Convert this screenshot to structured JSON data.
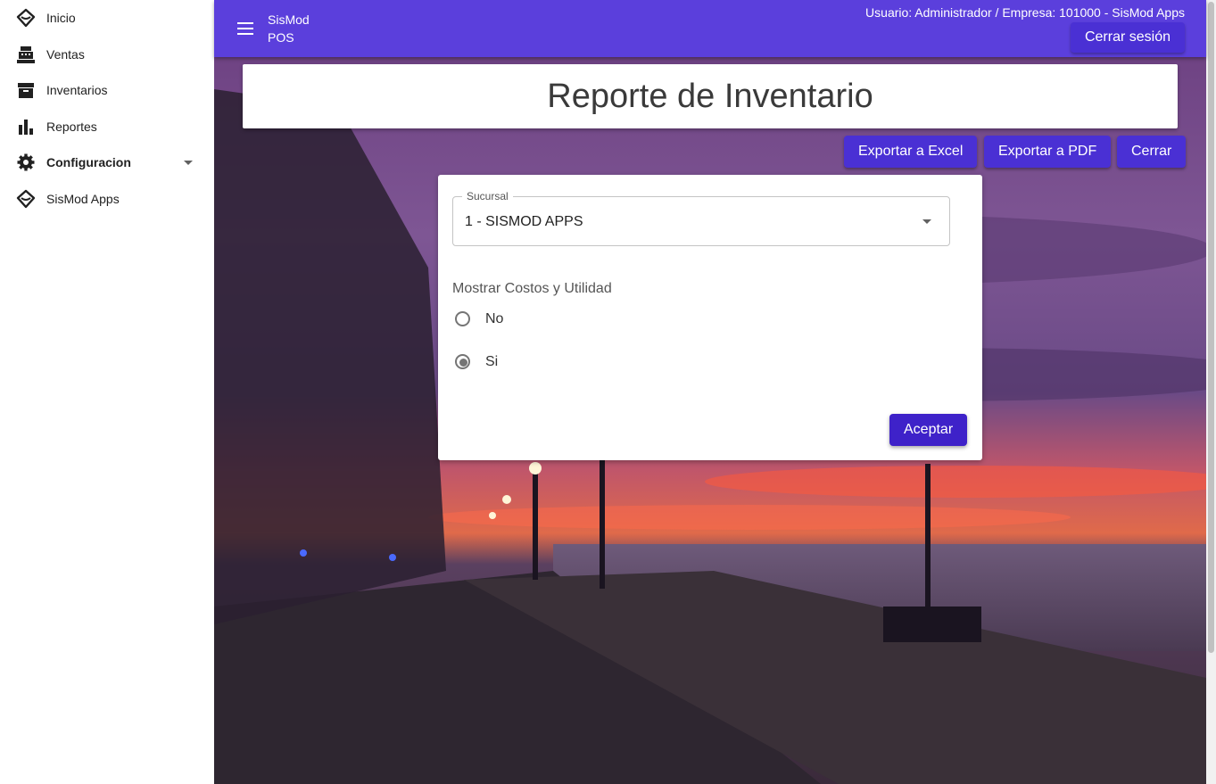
{
  "sidebar": {
    "items": [
      {
        "label": "Inicio",
        "icon": "sismod-logo-icon"
      },
      {
        "label": "Ventas",
        "icon": "cash-register-icon"
      },
      {
        "label": "Inventarios",
        "icon": "archive-box-icon"
      },
      {
        "label": "Reportes",
        "icon": "bar-chart-icon"
      },
      {
        "label": "Configuracion",
        "icon": "gear-icon"
      },
      {
        "label": "SisMod Apps",
        "icon": "sismod-logo-icon"
      }
    ]
  },
  "appbar": {
    "title_line1": "SisMod",
    "title_line2": "POS",
    "user_info": "Usuario: Administrador / Empresa: 101000 - SisMod Apps",
    "logout_label": "Cerrar sesión",
    "color": "#5b3fdc"
  },
  "page": {
    "title": "Reporte de Inventario"
  },
  "actions": {
    "export_excel": "Exportar a Excel",
    "export_pdf": "Exportar a PDF",
    "close": "Cerrar"
  },
  "form": {
    "sucursal_label": "Sucursal",
    "sucursal_value": "1 - SISMOD APPS",
    "costs_label": "Mostrar Costos y Utilidad",
    "options": [
      {
        "label": "No",
        "checked": false
      },
      {
        "label": "Si",
        "checked": true
      }
    ],
    "accept_label": "Aceptar"
  },
  "colors": {
    "primary": "#5b3fdc",
    "button": "#4a30d4",
    "accept": "#3e22c9"
  }
}
